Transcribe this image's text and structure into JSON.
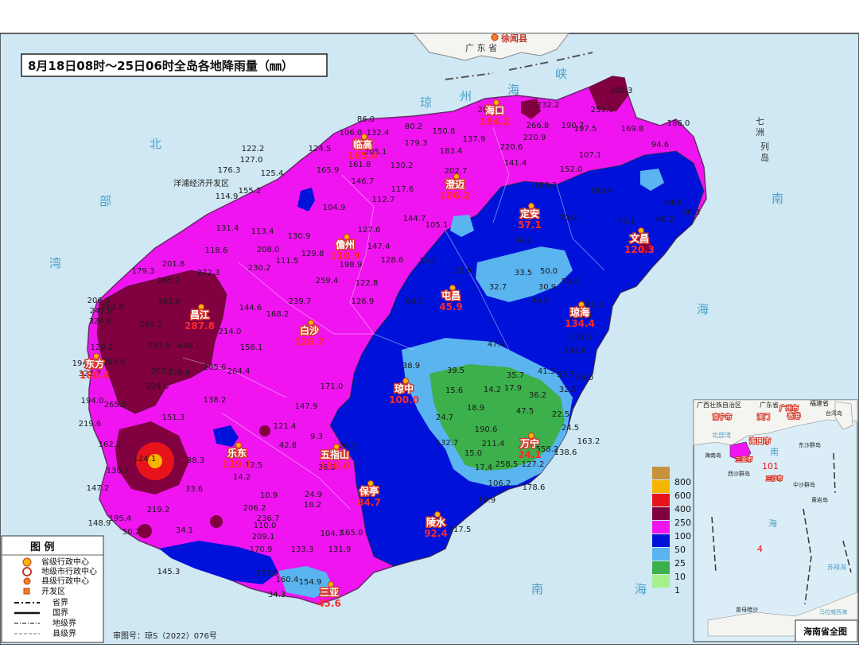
{
  "title": "8月18日08时～25日06时全岛各地降雨量（㎜）",
  "review_no": "审图号：琼S（2022）076号",
  "province_label": "广 东 省",
  "top_county": "徐闻县",
  "sea_labels": [
    "琼",
    "州",
    "海",
    "峡",
    "北",
    "部",
    "湾",
    "南",
    "海",
    "南",
    "海",
    "七",
    "洲",
    "列",
    "岛"
  ],
  "west_note": "洋浦经济开发区",
  "cities": [
    {
      "name": "海口",
      "value": "194.2"
    },
    {
      "name": "临高",
      "value": "165.4"
    },
    {
      "name": "澄迈",
      "value": "106.2"
    },
    {
      "name": "儋州",
      "value": "110.9"
    },
    {
      "name": "定安",
      "value": "57.1"
    },
    {
      "name": "文昌",
      "value": "120.3"
    },
    {
      "name": "屯昌",
      "value": "45.9"
    },
    {
      "name": "琼海",
      "value": "134.4"
    },
    {
      "name": "昌江",
      "value": "287.8"
    },
    {
      "name": "白沙",
      "value": "126.7"
    },
    {
      "name": "东方",
      "value": "180.4"
    },
    {
      "name": "琼中",
      "value": "100.0"
    },
    {
      "name": "乐东",
      "value": "119.1"
    },
    {
      "name": "五指山",
      "value": "136.0"
    },
    {
      "name": "万宁",
      "value": "24.1"
    },
    {
      "name": "保亭",
      "value": "84.7"
    },
    {
      "name": "陵水",
      "value": "92.4"
    },
    {
      "name": "三亚",
      "value": "45.6"
    }
  ],
  "station_values": [
    "200.3",
    "253.0",
    "232.2",
    "206.5",
    "186.0",
    "86.0",
    "80.2",
    "150.8",
    "106.0",
    "132.4",
    "179.3",
    "137.9",
    "266.8",
    "190.7",
    "197.5",
    "169.8",
    "94.6",
    "220.9",
    "122.2",
    "124.5",
    "205.1",
    "183.4",
    "220.6",
    "107.1",
    "127.0",
    "161.8",
    "130.2",
    "202.7",
    "141.4",
    "152.0",
    "176.3",
    "125.4",
    "165.9",
    "146.7",
    "117.6",
    "188.2",
    "109.4",
    "44.6",
    "104.9",
    "155.2",
    "112.7",
    "114.9",
    "131.4",
    "113.4",
    "127.6",
    "144.7",
    "105.1",
    "70.0",
    "73.1",
    "46.2",
    "30.3",
    "130.9",
    "147.4",
    "54.1",
    "118.6",
    "208.0",
    "129.8",
    "128.6",
    "16.3",
    "23.6",
    "33.5",
    "50.0",
    "201.8",
    "179.3",
    "230.2",
    "111.5",
    "198.9",
    "32.7",
    "30.9",
    "50.8",
    "265.2",
    "272.3",
    "259.4",
    "122.8",
    "206.3",
    "262.8",
    "361.0",
    "239.7",
    "168.2",
    "144.6",
    "126.9",
    "69.2",
    "46.0",
    "211.1",
    "241.0",
    "324.6",
    "264.2",
    "214.0",
    "190.3",
    "129.2",
    "233.0",
    "446.1",
    "158.1",
    "47.4",
    "211.2",
    "243.6",
    "194.3",
    "285.0",
    "38.9",
    "39.5",
    "35.7",
    "41.5",
    "53.7",
    "56.0",
    "322.7",
    "303.2",
    "178.8",
    "205.6",
    "171.0",
    "15.6",
    "14.2",
    "17.9",
    "36.2",
    "32.5",
    "194.0",
    "265.0",
    "224.0",
    "138.2",
    "147.9",
    "18.9",
    "47.5",
    "22.5",
    "24.5",
    "264.4",
    "151.3",
    "121.4",
    "9.3",
    "24.7",
    "190.6",
    "219.6",
    "162.2",
    "42.8",
    "26.3",
    "132.7",
    "211.4",
    "163.2",
    "124.1",
    "38.3",
    "12.5",
    "15.0",
    "558.2",
    "138.6",
    "130.7",
    "14.2",
    "36.9",
    "17.4",
    "258.5",
    "127.2",
    "147.2",
    "33.6",
    "10.9",
    "24.9",
    "106.2",
    "178.6",
    "219.2",
    "206.2",
    "18.2",
    "19.9",
    "148.9",
    "195.4",
    "236.7",
    "50.2",
    "34.1",
    "110.0",
    "209.1",
    "104.7",
    "165.0",
    "217.5",
    "170.9",
    "133.3",
    "131.9",
    "145.3",
    "173.0",
    "160.4",
    "154.9",
    "34.3",
    "76.9",
    "31.7",
    "28.1",
    "22.8"
  ],
  "legend_bar": {
    "labels": [
      "800",
      "600",
      "400",
      "250",
      "100",
      "50",
      "25",
      "10",
      "1"
    ],
    "colors": [
      "#c8923a",
      "#f7b500",
      "#e8121b",
      "#800040",
      "#f014f0",
      "#0012d9",
      "#5ab4f0",
      "#3cb04b",
      "#a4f08c"
    ]
  },
  "legend_box": {
    "title": "图 例",
    "items": [
      "省级行政中心",
      "地级市行政中心",
      "县级行政中心",
      "开发区",
      "省界",
      "国界",
      "地级界",
      "县级界"
    ]
  },
  "inset": {
    "footer": "海南省全图",
    "labels": [
      "广西壮族自治区",
      "福建省",
      "广东省",
      "南宁市",
      "澳门",
      "广州市",
      "香港",
      "台湾岛",
      "北部湾",
      "东沙群岛",
      "海口市",
      "海南岛",
      "三亚市",
      "西沙群岛",
      "三沙市",
      "中沙群岛",
      "黄岩岛",
      "南",
      "海",
      "苏禄海",
      "曾母暗沙",
      "马拉威西海",
      "101",
      "4"
    ]
  }
}
